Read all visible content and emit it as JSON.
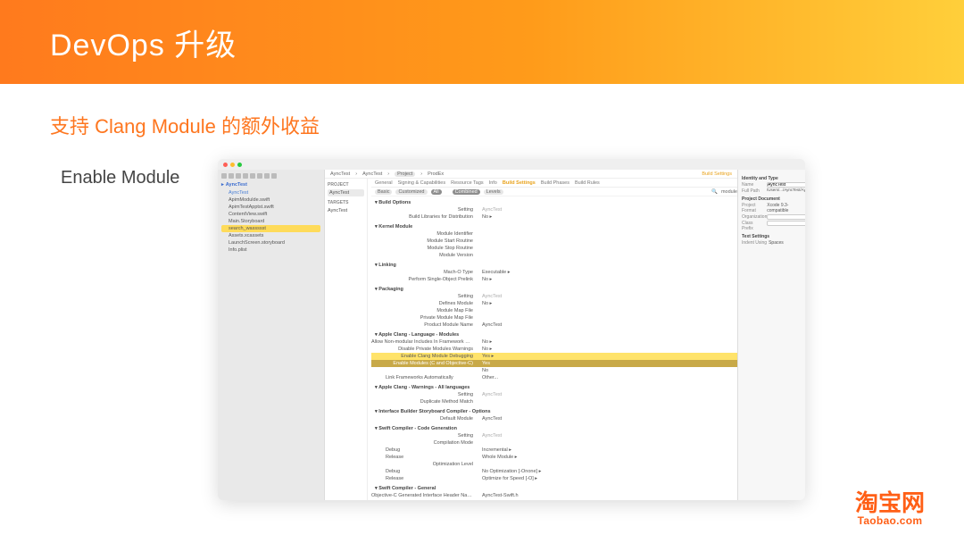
{
  "slide": {
    "title": "DevOps 升级",
    "subtitle": "支持 Clang Module 的额外收益",
    "label": "Enable Module"
  },
  "brand": {
    "cn": "淘宝网",
    "en": "Taobao.com"
  },
  "navigator": {
    "project": "AyncTest",
    "items": [
      {
        "name": "AyncTest",
        "blue": true
      },
      {
        "name": "ApimModulde.swift"
      },
      {
        "name": "ApimTestApptst.swift"
      },
      {
        "name": "ContentView.swift"
      },
      {
        "name": "Main.Storyboard"
      },
      {
        "name": "search_wassssst",
        "sel": true
      },
      {
        "name": "Assets.xcassets"
      },
      {
        "name": "LaunchScreen.storyboard"
      },
      {
        "name": "Info.plist"
      }
    ]
  },
  "editor": {
    "crumbs": [
      "AyncTest",
      "AyncTest",
      "Project",
      "ProdEx"
    ],
    "crumbs2_tag": "Build Settings",
    "project_col": {
      "head": "PROJECT",
      "proj": "AyncTest",
      "targets_head": "TARGETS",
      "target": "AyncTest"
    },
    "tabs": [
      "General",
      "Signing & Capabilities",
      "Resource Tags",
      "Info",
      "Build Settings",
      "Build Phases",
      "Build Rules"
    ],
    "filter": {
      "basic": "Basic",
      "customized": "Customized",
      "all": "All",
      "combined": "Combined",
      "levels": "Levels",
      "search": "module"
    },
    "valcol": "AyncTest",
    "sections": [
      {
        "title": "Build Options",
        "rows": [
          {
            "k": "Setting",
            "v": "AyncTest",
            "grey": true
          },
          {
            "k": "Build Libraries for Distribution",
            "v": "No ▸"
          }
        ]
      },
      {
        "title": "Kernel Module",
        "rows": [
          {
            "k": "Module Identifier",
            "v": ""
          },
          {
            "k": "Module Start Routine",
            "v": ""
          },
          {
            "k": "Module Stop Routine",
            "v": ""
          },
          {
            "k": "Module Version",
            "v": ""
          }
        ]
      },
      {
        "title": "Linking",
        "rows": [
          {
            "k": "Mach-O Type",
            "v": "Executable ▸"
          },
          {
            "k": "Perform Single-Object Prelink",
            "v": "No ▸"
          }
        ]
      },
      {
        "title": "Packaging",
        "rows": [
          {
            "k": "Setting",
            "v": "AyncTest",
            "grey": true
          },
          {
            "k": "Defines Module",
            "v": "No ▸"
          },
          {
            "k": "Module Map File",
            "v": ""
          },
          {
            "k": "Private Module Map File",
            "v": ""
          },
          {
            "k": "Product Module Name",
            "v": "AyncTest"
          }
        ]
      },
      {
        "title": "Apple Clang - Language - Modules",
        "rows": [
          {
            "k": "Allow Non-modular Includes In Framework Modules",
            "v": "No ▸"
          },
          {
            "k": "Disable Private Modules Warnings",
            "v": "No ▸"
          },
          {
            "k": "Enable Clang Module Debugging",
            "v": "Yes ▸",
            "hl": "yellow"
          },
          {
            "k": "Enable Modules (C and Objective-C)",
            "v": "Yes",
            "hl": "dark"
          },
          {
            "k": "",
            "v": "No",
            "sub": true
          },
          {
            "k": "Link Frameworks Automatically",
            "v": "Other...",
            "sub": true
          }
        ]
      },
      {
        "title": "Apple Clang - Warnings - All languages",
        "rows": [
          {
            "k": "Setting",
            "v": "AyncTest",
            "grey": true
          },
          {
            "k": "Duplicate Method Match",
            "v": ""
          }
        ]
      },
      {
        "title": "Interface Builder Storyboard Compiler - Options",
        "rows": [
          {
            "k": "Default Module",
            "v": "AyncTest"
          }
        ]
      },
      {
        "title": "Swift Compiler - Code Generation",
        "rows": [
          {
            "k": "Setting",
            "v": "AyncTest",
            "grey": true
          },
          {
            "k": "Compilation Mode",
            "v": ""
          },
          {
            "k": "Debug",
            "v": "Incremental ▸",
            "sub": true
          },
          {
            "k": "Release",
            "v": "Whole Module ▸",
            "sub": true
          },
          {
            "k": "Optimization Level",
            "v": ""
          },
          {
            "k": "Debug",
            "v": "No Optimization [-Onone] ▸",
            "sub": true
          },
          {
            "k": "Release",
            "v": "Optimize for Speed [-O] ▸",
            "sub": true
          }
        ]
      },
      {
        "title": "Swift Compiler - General",
        "rows": [
          {
            "k": "Objective-C Generated Interface Header Name",
            "v": "AyncTest-Swift.h"
          }
        ]
      }
    ]
  },
  "inspector": {
    "top": "Identity and Type",
    "name_field": "Name",
    "name_value": "AyncTest",
    "path_label": "Full Path",
    "path_value": "/Users/.../AyncTest/AyncTest.xcodeproj",
    "pd_head": "Project Document",
    "format_label": "Project Format",
    "format_value": "Xcode 9.3-compatible",
    "org_label": "Organization",
    "class_label": "Class Prefix",
    "ts_head": "Text Settings",
    "indent_label": "Indent Using",
    "indent_value": "Spaces"
  }
}
